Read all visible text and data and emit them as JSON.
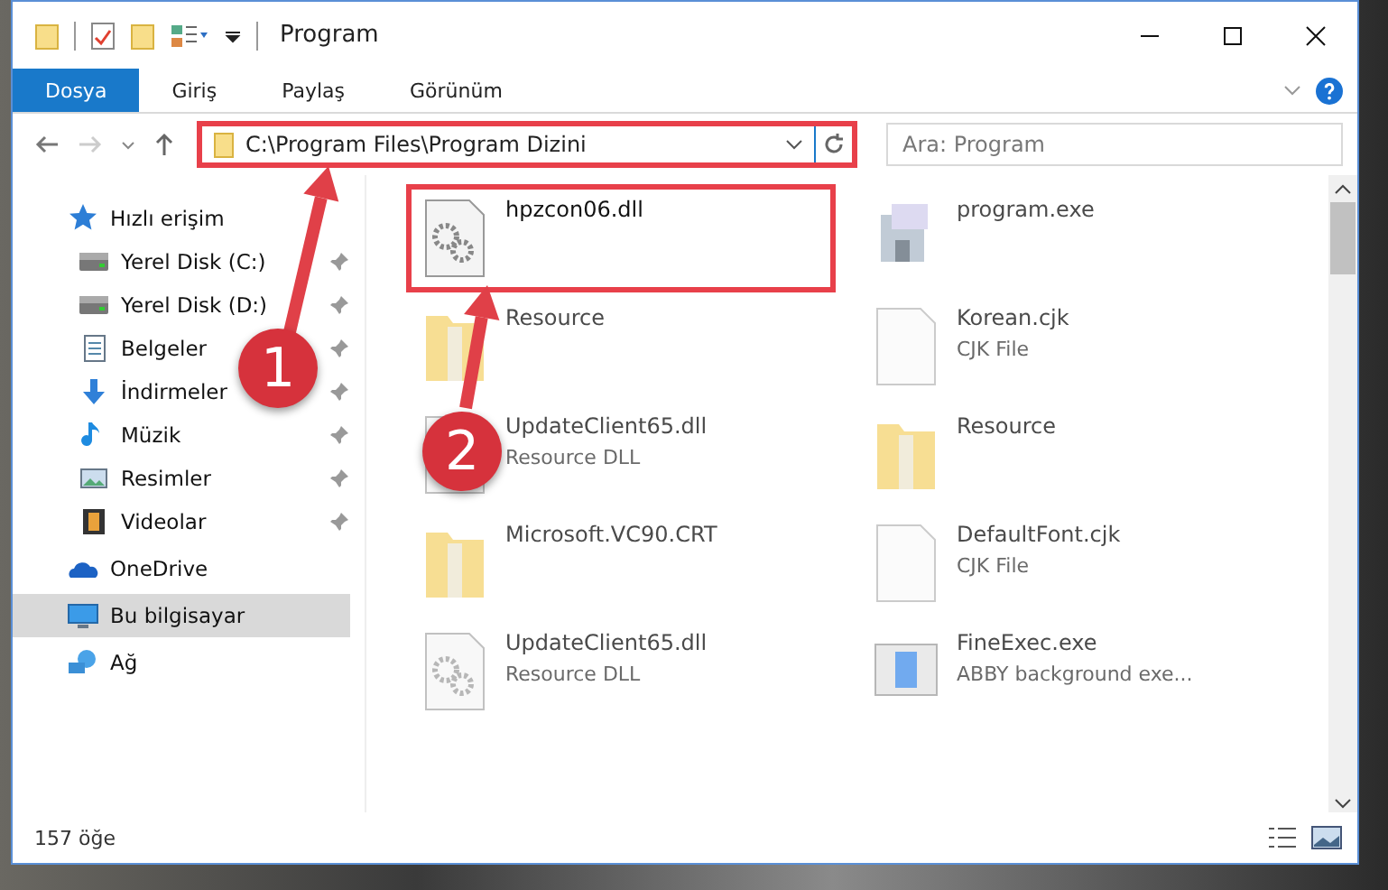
{
  "window": {
    "title": "Program"
  },
  "ribbon_tabs": [
    {
      "label": "Dosya",
      "selected": true
    },
    {
      "label": "Giriş",
      "selected": false
    },
    {
      "label": "Paylaş",
      "selected": false
    },
    {
      "label": "Görünüm",
      "selected": false
    }
  ],
  "address_bar": {
    "path": "C:\\Program Files\\Program Dizini",
    "highlighted": true
  },
  "search": {
    "placeholder": "Ara: Program"
  },
  "sidebar": {
    "items": [
      {
        "label": "Hızlı erişim",
        "kind": "star",
        "pinned": false,
        "selected": false,
        "children": [
          {
            "label": "Yerel Disk (C:)",
            "kind": "drive",
            "pinned": true,
            "selected": false
          },
          {
            "label": "Yerel Disk (D:)",
            "kind": "drive",
            "pinned": true,
            "selected": false
          },
          {
            "label": "Belgeler",
            "kind": "document",
            "pinned": true,
            "selected": false
          },
          {
            "label": "İndirmeler",
            "kind": "download",
            "pinned": true,
            "selected": false
          },
          {
            "label": "Müzik",
            "kind": "music",
            "pinned": true,
            "selected": false
          },
          {
            "label": "Resimler",
            "kind": "pictures",
            "pinned": true,
            "selected": false
          },
          {
            "label": "Videolar",
            "kind": "video",
            "pinned": true,
            "selected": false
          }
        ]
      },
      {
        "label": "OneDrive",
        "kind": "cloud",
        "pinned": false,
        "selected": false
      },
      {
        "label": "Bu bilgisayar",
        "kind": "computer",
        "pinned": false,
        "selected": true
      },
      {
        "label": "Ağ",
        "kind": "network",
        "pinned": false,
        "selected": false
      }
    ]
  },
  "files": [
    {
      "name": "hpzcon06.dll",
      "kind": "dll",
      "blurred": false,
      "highlighted": true
    },
    {
      "name": "program.exe",
      "kind": "exe",
      "blurred": true,
      "highlighted": false
    },
    {
      "name": "Resource",
      "kind": "folder",
      "blurred": true,
      "highlighted": false
    },
    {
      "name": "Korean.cjk",
      "type": "CJK File",
      "kind": "blank",
      "blurred": true,
      "highlighted": false
    },
    {
      "name": "UpdateClient65.dll",
      "type": "Resource DLL",
      "kind": "dll",
      "blurred": true,
      "highlighted": false
    },
    {
      "name": "Resource",
      "kind": "folder",
      "blurred": true,
      "highlighted": false
    },
    {
      "name": "Microsoft.VC90.CRT",
      "kind": "folder",
      "blurred": true,
      "highlighted": false
    },
    {
      "name": "DefaultFont.cjk",
      "type": "CJK File",
      "kind": "blank",
      "blurred": true,
      "highlighted": false
    },
    {
      "name": "UpdateClient65.dll",
      "type": "Resource DLL",
      "kind": "dll",
      "blurred": true,
      "highlighted": false
    },
    {
      "name": "FineExec.exe",
      "type": "ABBY background exe...",
      "kind": "app",
      "blurred": true,
      "highlighted": false
    }
  ],
  "status_bar": {
    "count": "157 öğe"
  },
  "annotations": [
    {
      "number": "1"
    },
    {
      "number": "2"
    }
  ]
}
